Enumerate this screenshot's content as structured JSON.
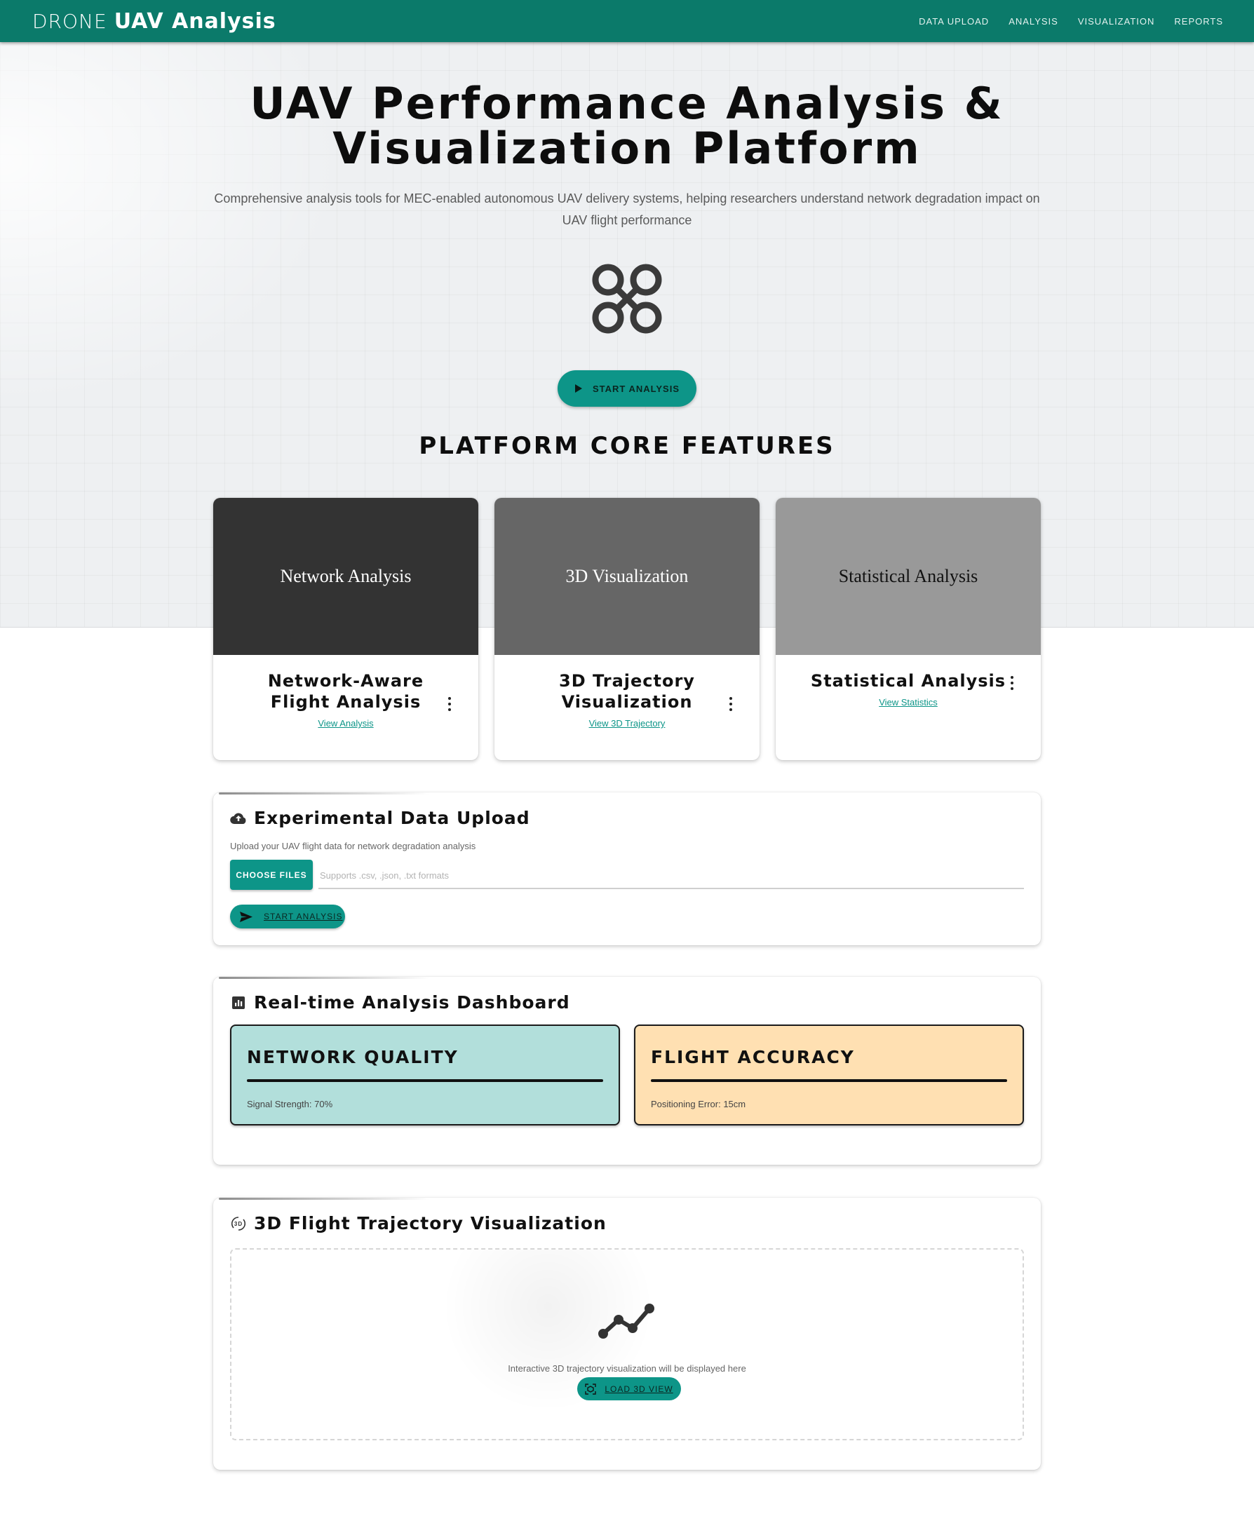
{
  "header": {
    "brand_light": "DRONE",
    "brand_bold": "UAV Analysis",
    "nav": [
      "DATA UPLOAD",
      "ANALYSIS",
      "VISUALIZATION",
      "REPORTS"
    ]
  },
  "hero": {
    "title_line1": "UAV Performance Analysis &",
    "title_line2": "Visualization Platform",
    "subtitle": "Comprehensive analysis tools for MEC-enabled autonomous UAV delivery systems, helping researchers understand network degradation impact on UAV flight performance",
    "icon": "drone-icon",
    "cta_label": "START ANALYSIS"
  },
  "features": {
    "heading": "PLATFORM CORE FEATURES",
    "cards": [
      {
        "media_text": "Network Analysis",
        "title": "Network-Aware Flight Analysis",
        "link": "View Analysis",
        "media_color": "#333333"
      },
      {
        "media_text": "3D Visualization",
        "title": "3D Trajectory Visualization",
        "link": "View 3D Trajectory",
        "media_color": "#666666"
      },
      {
        "media_text": "Statistical Analysis",
        "title": "Statistical Analysis",
        "link": "View Statistics",
        "media_color": "#999999"
      }
    ]
  },
  "upload": {
    "title": "Experimental Data Upload",
    "subtitle": "Upload your UAV flight data for network degradation analysis",
    "choose_label": "CHOOSE FILES",
    "placeholder": "Supports .csv, .json, .txt formats",
    "start_label": "START ANALYSIS"
  },
  "dashboard": {
    "title": "Real-time Analysis Dashboard",
    "metrics": [
      {
        "label": "NETWORK QUALITY",
        "value": "Signal Strength: 70%",
        "color": "#b2dfdb"
      },
      {
        "label": "FLIGHT ACCURACY",
        "value": "Positioning Error: 15cm",
        "color": "#ffe0b2"
      }
    ]
  },
  "trajectory": {
    "title": "3D Flight Trajectory Visualization",
    "placeholder_text": "Interactive 3D trajectory visualization will be displayed here",
    "button_label": "LOAD 3D VIEW"
  },
  "colors": {
    "primary": "#0b7a6a",
    "accent": "#0d9588"
  }
}
